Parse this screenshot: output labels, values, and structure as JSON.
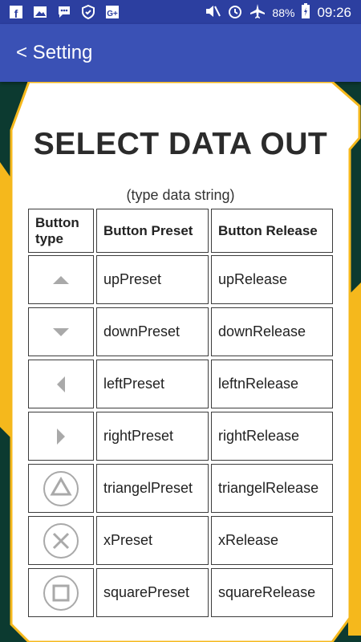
{
  "status_bar": {
    "battery": "88%",
    "time": "09:26"
  },
  "app_bar": {
    "back_title": "< Setting"
  },
  "page": {
    "heading": "SELECT DATA OUT",
    "subheading": "(type data string)"
  },
  "table": {
    "headers": [
      "Button type",
      "Button Preset",
      "Button Release"
    ],
    "rows": [
      {
        "icon": "arrow-up-icon",
        "preset": "upPreset",
        "release": "upRelease"
      },
      {
        "icon": "arrow-down-icon",
        "preset": "downPreset",
        "release": "downRelease"
      },
      {
        "icon": "arrow-left-icon",
        "preset": "leftPreset",
        "release": "leftnRelease"
      },
      {
        "icon": "arrow-right-icon",
        "preset": "rightPreset",
        "release": "rightRelease"
      },
      {
        "icon": "triangle-icon",
        "preset": "triangelPreset",
        "release": "triangelRelease"
      },
      {
        "icon": "x-icon",
        "preset": "xPreset",
        "release": "xRelease"
      },
      {
        "icon": "square-icon",
        "preset": "squarePreset",
        "release": "squareRelease"
      }
    ]
  },
  "colors": {
    "status_bar": "#2c3fa0",
    "app_bar": "#3a51b5",
    "background": "#0c3a30",
    "frame_border": "#f5b81c",
    "icon_gray": "#a9a9a9"
  }
}
